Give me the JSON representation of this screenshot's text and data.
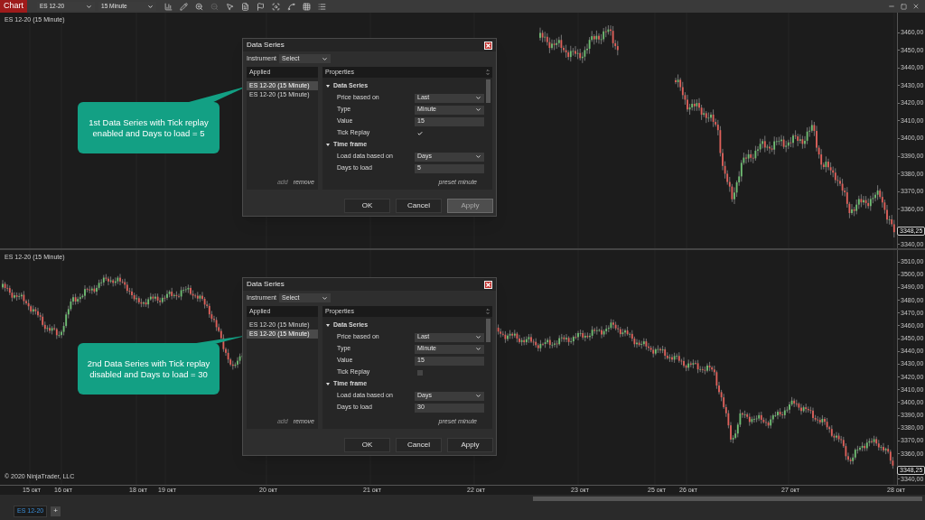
{
  "toolbar": {
    "app_button": "Chart",
    "instrument": "ES 12-20",
    "interval": "15 Minute"
  },
  "panels": [
    {
      "label": "ES 12-20 (15 Minute)",
      "price_ticks": [
        "3460,00",
        "3450,00",
        "3440,00",
        "3430,00",
        "3420,00",
        "3410,00",
        "3400,00",
        "3390,00",
        "3380,00",
        "3370,00",
        "3360,00",
        "3340,00"
      ],
      "last_price": "3348,25",
      "dialog": {
        "title": "Data Series",
        "instrument_label": "Instrument",
        "instrument_value": "Select",
        "applied_header": "Applied",
        "series": [
          {
            "label": "ES 12-20 (15 Minute)",
            "selected": true
          },
          {
            "label": "ES 12-20 (15 Minute)",
            "selected": false
          }
        ],
        "add": {
          "label": "add",
          "disabled": true
        },
        "remove": "remove",
        "properties_header": "Properties",
        "sections": [
          {
            "title": "Data Series",
            "expanded": true,
            "rows": [
              {
                "label": "Price based on",
                "kind": "dropdown",
                "value": "Last"
              },
              {
                "label": "Type",
                "kind": "dropdown",
                "value": "Minute"
              },
              {
                "label": "Value",
                "kind": "input",
                "value": "15"
              },
              {
                "label": "Tick Replay",
                "kind": "checkbox",
                "checked": true
              }
            ]
          },
          {
            "title": "Time frame",
            "expanded": true,
            "rows": [
              {
                "label": "Load data based on",
                "kind": "dropdown",
                "value": "Days"
              },
              {
                "label": "Days to load",
                "kind": "input",
                "value": "5"
              }
            ]
          }
        ],
        "preset_link": "preset minute",
        "buttons": [
          {
            "label": "OK",
            "disabled": false
          },
          {
            "label": "Cancel",
            "disabled": false
          },
          {
            "label": "Apply",
            "disabled": true
          }
        ]
      },
      "callout": "1st Data Series with Tick replay enabled and Days to load = 5"
    },
    {
      "label": "ES 12-20 (15 Minute)",
      "price_ticks": [
        "3510,00",
        "3500,00",
        "3490,00",
        "3480,00",
        "3470,00",
        "3460,00",
        "3450,00",
        "3440,00",
        "3430,00",
        "3420,00",
        "3410,00",
        "3400,00",
        "3390,00",
        "3380,00",
        "3370,00",
        "3360,00",
        "3340,00"
      ],
      "last_price": "3348,25",
      "dialog": {
        "title": "Data Series",
        "instrument_label": "Instrument",
        "instrument_value": "Select",
        "applied_header": "Applied",
        "series": [
          {
            "label": "ES 12-20 (15 Minute)",
            "selected": false
          },
          {
            "label": "ES 12-20 (15 Minute)",
            "selected": true
          }
        ],
        "add": {
          "label": "add",
          "disabled": true
        },
        "remove": "remove",
        "properties_header": "Properties",
        "sections": [
          {
            "title": "Data Series",
            "expanded": true,
            "rows": [
              {
                "label": "Price based on",
                "kind": "dropdown",
                "value": "Last"
              },
              {
                "label": "Type",
                "kind": "dropdown",
                "value": "Minute"
              },
              {
                "label": "Value",
                "kind": "input",
                "value": "15"
              },
              {
                "label": "Tick Replay",
                "kind": "checkbox",
                "checked": false
              }
            ]
          },
          {
            "title": "Time frame",
            "expanded": true,
            "rows": [
              {
                "label": "Load data based on",
                "kind": "dropdown",
                "value": "Days"
              },
              {
                "label": "Days to load",
                "kind": "input",
                "value": "30"
              }
            ]
          }
        ],
        "preset_link": "preset minute",
        "buttons": [
          {
            "label": "OK",
            "disabled": false
          },
          {
            "label": "Cancel",
            "disabled": false
          },
          {
            "label": "Apply",
            "disabled": false
          }
        ]
      },
      "callout": "2nd Data Series with Tick replay disabled and Days to load = 30",
      "copyright": "© 2020 NinjaTrader, LLC"
    }
  ],
  "time_ticks": [
    "15 окт",
    "16 окт",
    "18 окт",
    "19 окт",
    "20 окт",
    "21 окт",
    "22 окт",
    "23 окт",
    "25 окт",
    "26 окт",
    "27 окт",
    "28 окт"
  ],
  "tabs": [
    {
      "label": "ES 12-20",
      "selected": true
    }
  ],
  "add_tab": "+"
}
